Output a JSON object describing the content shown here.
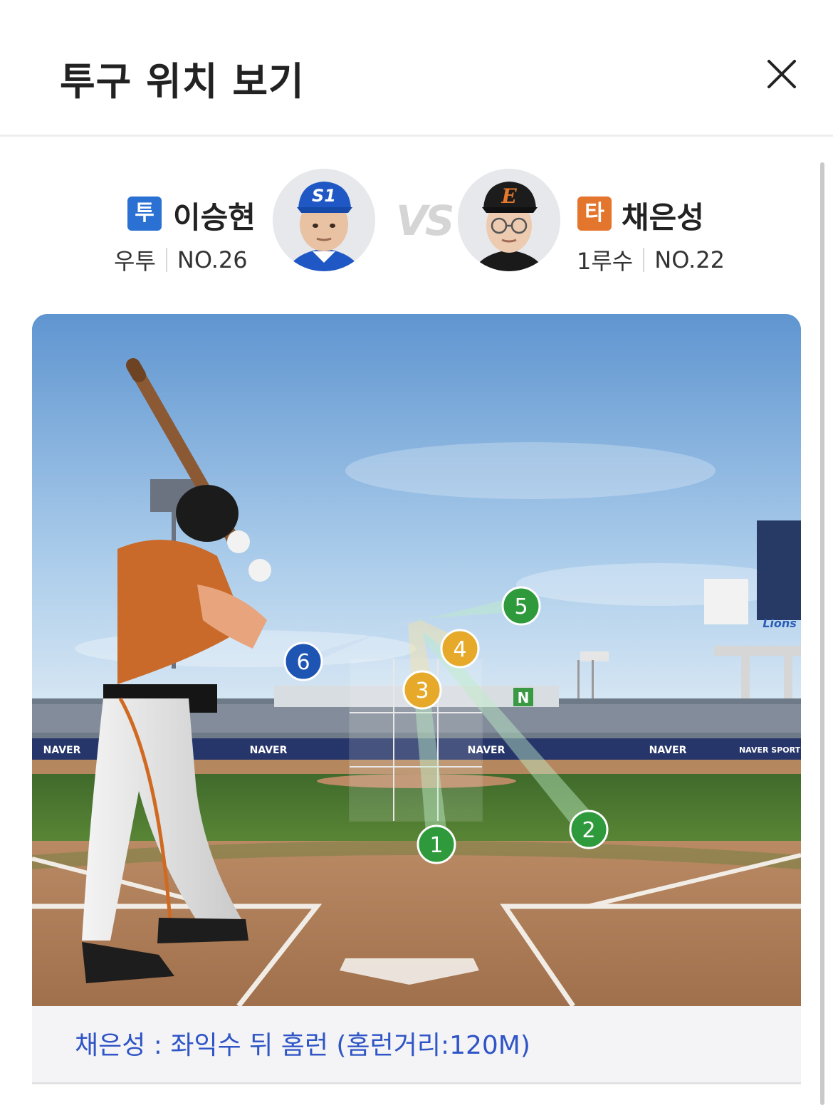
{
  "modal": {
    "title": "투구 위치 보기"
  },
  "pitcher": {
    "role_badge": "투",
    "name": "이승현",
    "position": "우투",
    "number": "NO.26",
    "cap_logo": "S1",
    "cap_color": "#1f58c4"
  },
  "vs_label": "VS",
  "batter": {
    "role_badge": "타",
    "name": "채은성",
    "position": "1루수",
    "number": "NO.22",
    "cap_logo": "E",
    "cap_color": "#1c1c1c"
  },
  "field": {
    "signage": [
      "NAVER",
      "NAVER",
      "NAVER",
      "NAVER"
    ],
    "sponsor": "NAVER SPORTS",
    "scoreboard_logo": "Lions",
    "pitches": [
      {
        "number": "1",
        "result": "strike",
        "color": "#2e9a3c"
      },
      {
        "number": "2",
        "result": "strike",
        "color": "#2e9a3c"
      },
      {
        "number": "3",
        "result": "ball",
        "color": "#e6a929"
      },
      {
        "number": "4",
        "result": "ball",
        "color": "#e6a929"
      },
      {
        "number": "5",
        "result": "strike",
        "color": "#2e9a3c"
      },
      {
        "number": "6",
        "result": "in-play",
        "color": "#1e55b3"
      }
    ]
  },
  "result": {
    "text": "채은성 : 좌익수 뒤 홈런 (홈런거리:120M)"
  },
  "colors": {
    "pitcher_badge": "#2b71d3",
    "batter_badge": "#e4752d",
    "result_text": "#2f55c6"
  }
}
